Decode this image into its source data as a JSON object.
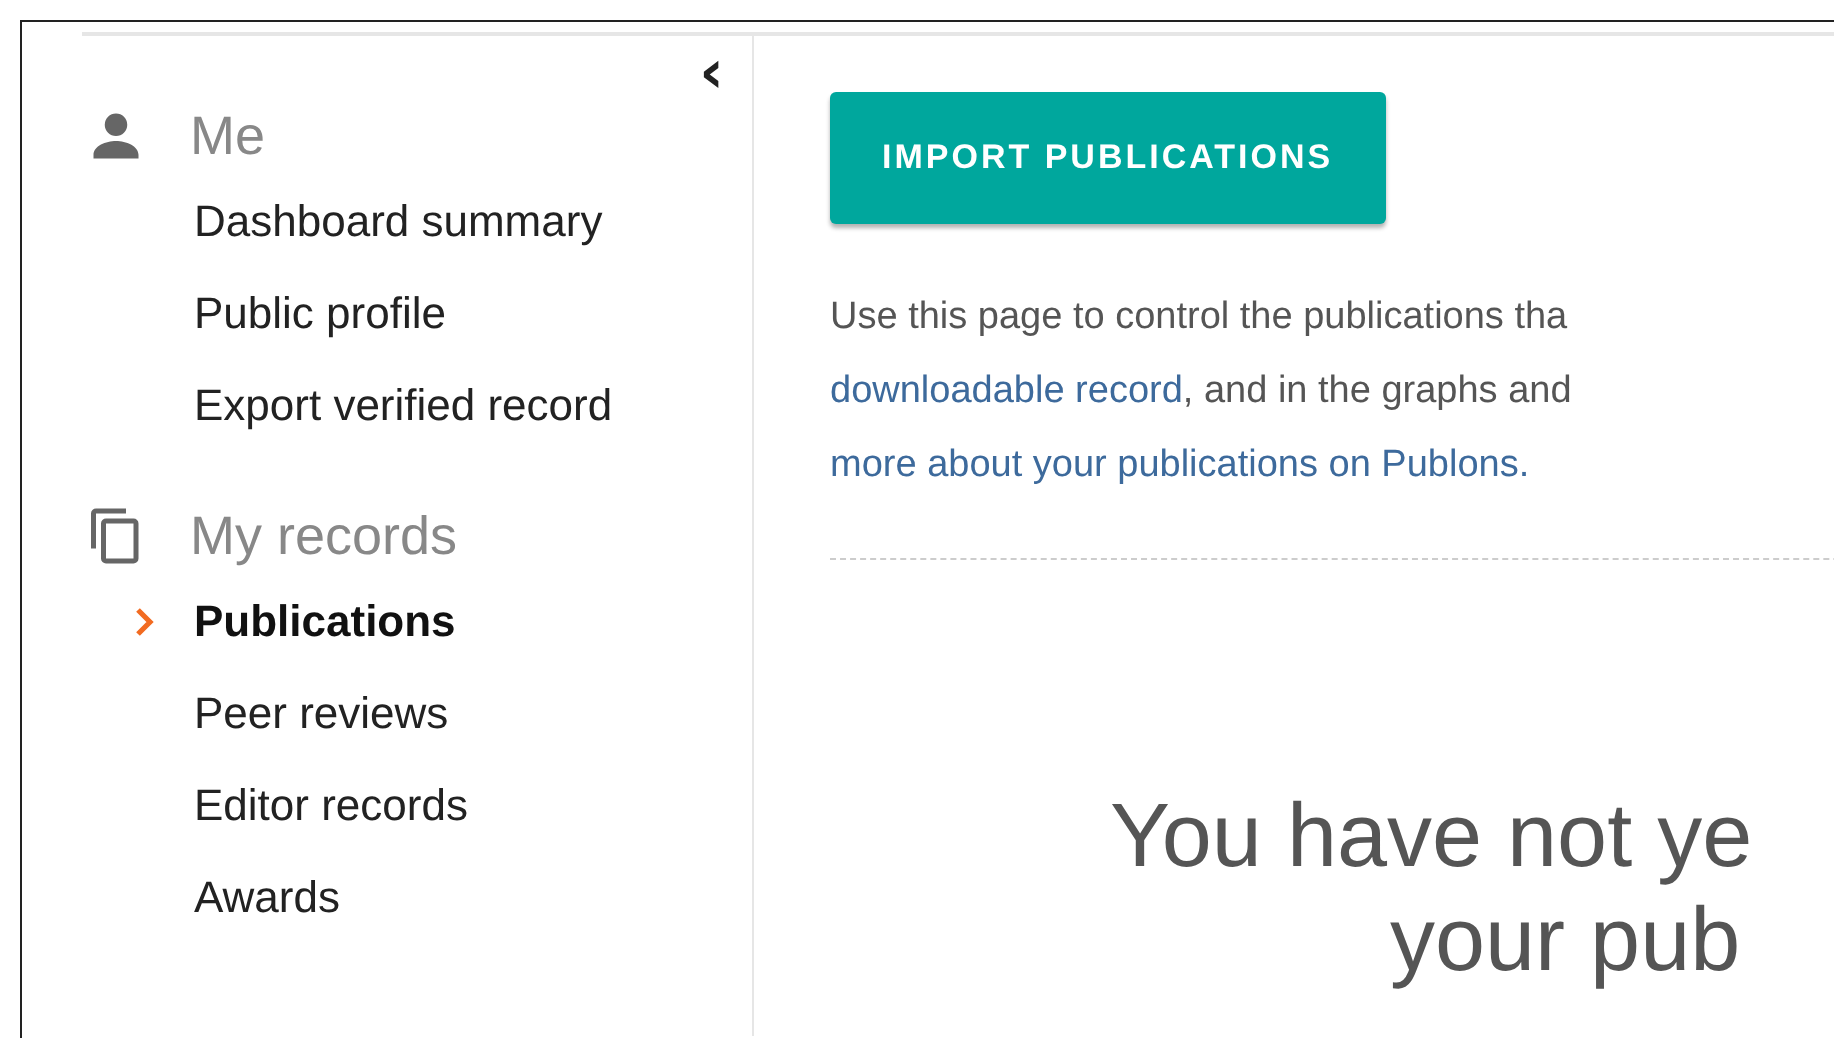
{
  "sidebar": {
    "collapse_icon": "‹",
    "sections": [
      {
        "kind": "person",
        "title": "Me",
        "items": [
          {
            "label": "Dashboard summary",
            "selected": false
          },
          {
            "label": "Public profile",
            "selected": false
          },
          {
            "label": "Export verified record",
            "selected": false
          }
        ]
      },
      {
        "kind": "records",
        "title": "My records",
        "items": [
          {
            "label": "Publications",
            "selected": true
          },
          {
            "label": "Peer reviews",
            "selected": false
          },
          {
            "label": "Editor records",
            "selected": false
          },
          {
            "label": "Awards",
            "selected": false
          }
        ]
      }
    ]
  },
  "main": {
    "import_button": "IMPORT PUBLICATIONS",
    "intro_lines": [
      [
        {
          "text": "Use this page to control the publications tha",
          "kind": "plain"
        }
      ],
      [
        {
          "text": "downloadable record",
          "kind": "link"
        },
        {
          "text": ", and in the graphs and",
          "kind": "plain"
        }
      ],
      [
        {
          "text": "more about your publications on Publons.",
          "kind": "link"
        }
      ]
    ],
    "empty_heading_lines": [
      "You have not ye",
      "your pub"
    ]
  }
}
